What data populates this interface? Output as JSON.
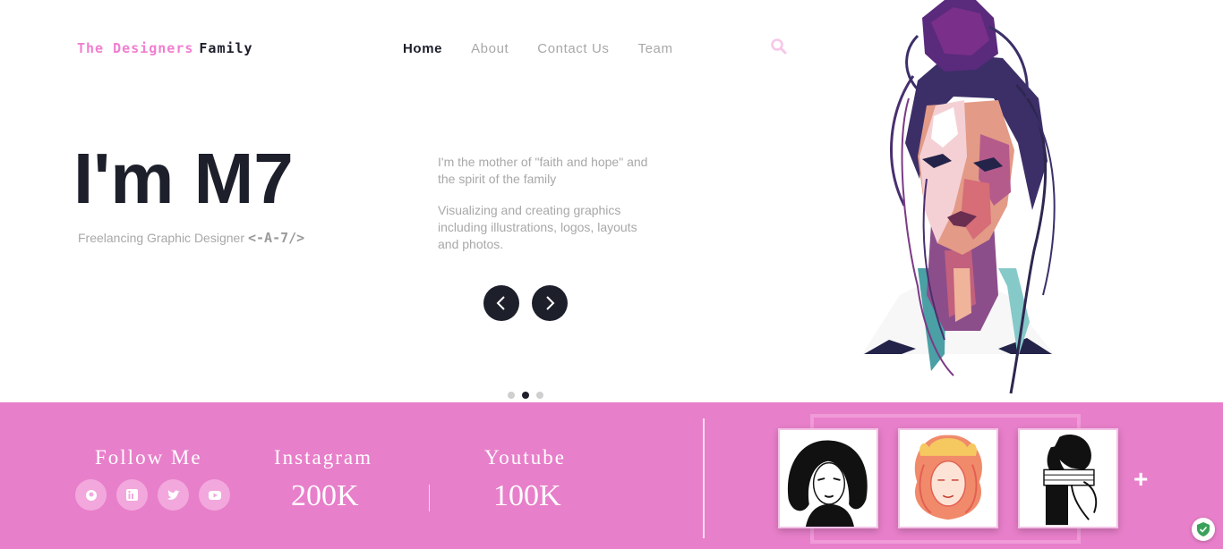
{
  "header": {
    "logo_part1": "The Designers",
    "logo_part2": "Family",
    "nav": [
      {
        "label": "Home",
        "active": true
      },
      {
        "label": "About",
        "active": false
      },
      {
        "label": "Contact Us",
        "active": false
      },
      {
        "label": "Team",
        "active": false
      }
    ],
    "search_icon": "search-icon"
  },
  "hero": {
    "title": "I'm M7",
    "subtitle": "Freelancing Graphic Designer",
    "signature": "<-A-7/>",
    "desc1": "I'm the mother of \"faith and hope\" and the spirit of the family",
    "desc2": "Visualizing and creating graphics including illustrations, logos, layouts and photos.",
    "slider": {
      "total": 3,
      "active_index": 1
    }
  },
  "stats": {
    "follow_title": "Follow Me",
    "instagram_title": "Instagram",
    "instagram_value": "200K",
    "youtube_title": "Youtube",
    "youtube_value": "100K"
  },
  "social_icons": [
    "github-icon",
    "linkedin-icon",
    "twitter-icon",
    "youtube-icon"
  ],
  "gallery": {
    "more_label": "+"
  },
  "colors": {
    "accent_pink": "#e87fca",
    "dark": "#1d1f2b",
    "muted_text": "#a8a8a8"
  }
}
